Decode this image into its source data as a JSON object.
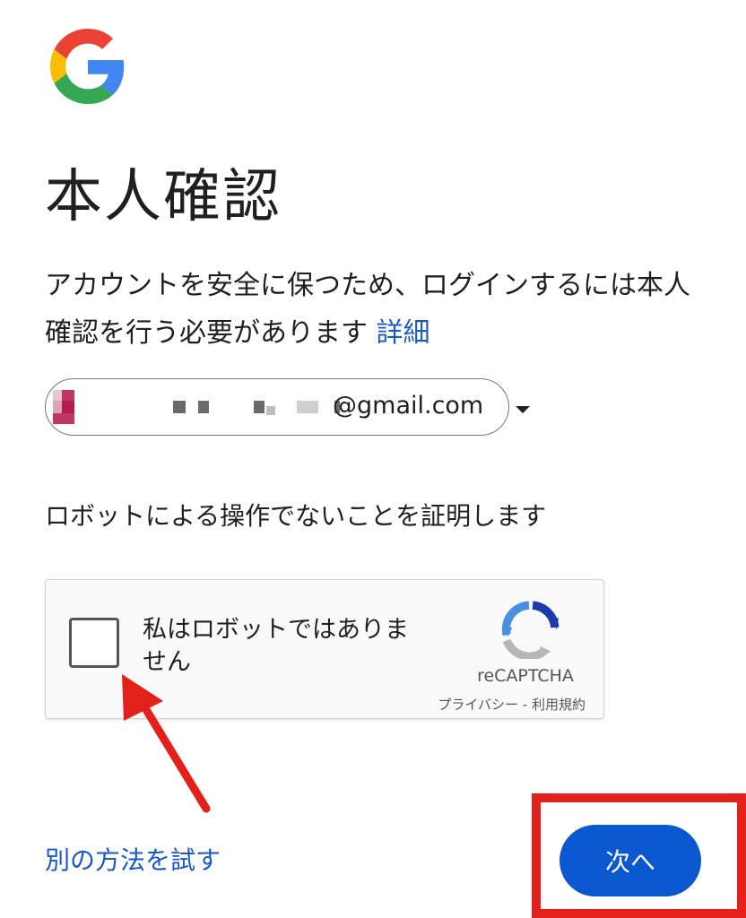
{
  "brand": {
    "logo_icon": "google-g-logo-icon"
  },
  "page": {
    "title": "本人確認",
    "description": "アカウントを安全に保つため、ログインするには本人確認を行う必要があります",
    "details_link": "詳細"
  },
  "account": {
    "email_suffix": "@gmail.com",
    "avatar_icon": "pixelated-avatar-icon",
    "dropdown_icon": "caret-down-icon"
  },
  "robot_prompt": "ロボットによる操作でないことを証明します",
  "recaptcha": {
    "checkbox_label": "私はロボットではありません",
    "brand": "reCAPTCHA",
    "links": "プライバシー - 利用規約",
    "logo_icon": "recaptcha-logo-icon"
  },
  "annotations": {
    "arrow_icon": "red-arrow-icon",
    "highlight_color": "#e4201b"
  },
  "actions": {
    "alt_method": "別の方法を試す",
    "next": "次へ"
  },
  "colors": {
    "link": "#1a57c9",
    "primary_button": "#0b57d0"
  }
}
